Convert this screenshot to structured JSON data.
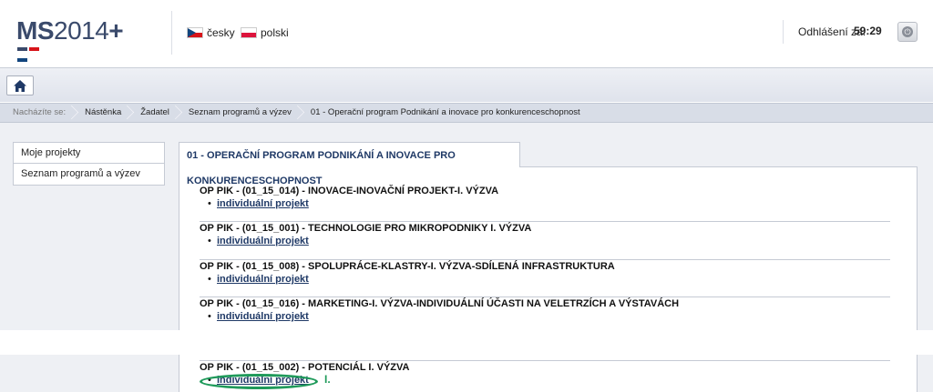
{
  "header": {
    "logo_ms": "MS",
    "logo_year": "2014",
    "logo_plus": "+",
    "languages": [
      {
        "label": "česky",
        "flag": "cz-flag-icon"
      },
      {
        "label": "polski",
        "flag": "pl-flag-icon"
      }
    ],
    "logout_label": "Odhlášení za:",
    "logout_timer": "59:29"
  },
  "breadcrumb": {
    "prefix": "Nacházíte se:",
    "items": [
      "Nástěnka",
      "Žadatel",
      "Seznam programů a výzev",
      "01 - Operační program Podnikání a inovace pro konkurenceschopnost"
    ]
  },
  "sidemenu": {
    "items": [
      "Moje projekty",
      "Seznam programů a výzev"
    ]
  },
  "main": {
    "tab_title": "01 - OPERAČNÍ PROGRAM PODNIKÁNÍ A INOVACE PRO KONKURENCESCHOPNOST",
    "programs": [
      {
        "title": "OP PIK - (01_15_014) - INOVACE-INOVAČNÍ PROJEKT-I. VÝZVA",
        "link": "individuální projekt"
      },
      {
        "title": "OP PIK - (01_15_001) - TECHNOLOGIE PRO MIKROPODNIKY I. VÝZVA",
        "link": "individuální projekt"
      },
      {
        "title": "OP PIK - (01_15_008) - SPOLUPRÁCE-KLASTRY-I. VÝZVA-SDÍLENÁ INFRASTRUKTURA",
        "link": "individuální projekt"
      },
      {
        "title": "OP PIK - (01_15_016) - MARKETING-I. VÝZVA-INDIVIDUÁLNÍ ÚČASTI NA VELETRZÍCH A VÝSTAVÁCH",
        "link": "individuální projekt"
      }
    ],
    "bottom_program": {
      "title": "OP PIK - (01_15_002) - POTENCIÁL I. VÝZVA",
      "link": "individuální projekt"
    },
    "annotation": "I."
  },
  "colors": {
    "accent_navy": "#1f3966",
    "annotation_green": "#1f9a5a"
  }
}
